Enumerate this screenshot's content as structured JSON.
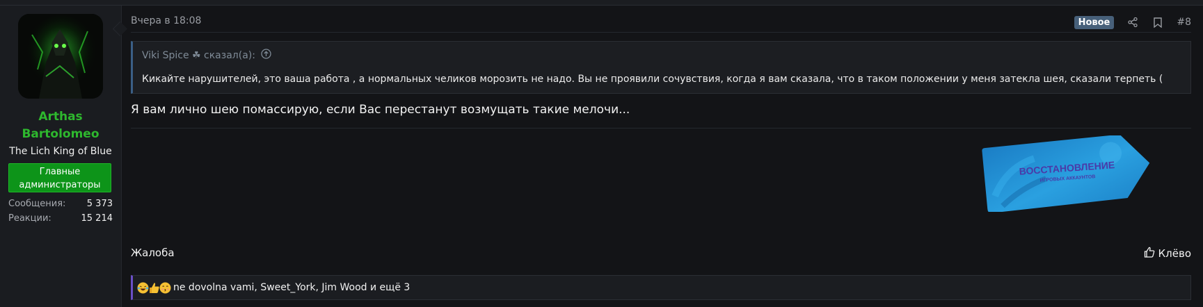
{
  "author": {
    "name_line1": "Arthas",
    "name_line2": "Bartolomeo",
    "title": "The Lich King of Blue",
    "role_badge_line1": "Главные",
    "role_badge_line2": "администраторы",
    "stats": [
      {
        "label": "Сообщения:",
        "value": "5 373"
      },
      {
        "label": "Реакции:",
        "value": "15 214"
      }
    ],
    "name_color": "#2eb82e",
    "badge_color": "#0d9419"
  },
  "post": {
    "date": "Вчера в 18:08",
    "new_badge": "Новое",
    "number": "#8",
    "quote": {
      "author": "Viki Spice ☘ сказал(а):",
      "text": "Кикайте нарушителей, это ваша работа , а нормальных челиков морозить не надо. Вы не проявили сочувствия, когда я вам сказала, что в таком положении у меня затекла шея, сказали терпеть ("
    },
    "text": "Я вам лично шею помассирую, если Вас перестанут возмущать такие мелочи...",
    "signature_text_line1": "ВОССТАНОВЛЕНИЕ",
    "signature_text_line2": "ИГРОВЫХ АККАУНТОВ"
  },
  "actions": {
    "report": "Жалоба",
    "like": "Клёво"
  },
  "reactions": {
    "icons": [
      "laughing-emoji-icon",
      "thumbs-up-emoji-icon",
      "kiss-emoji-icon"
    ],
    "text": "ne dovolna vami, Sweet_York, Jim Wood и ещё 3"
  }
}
